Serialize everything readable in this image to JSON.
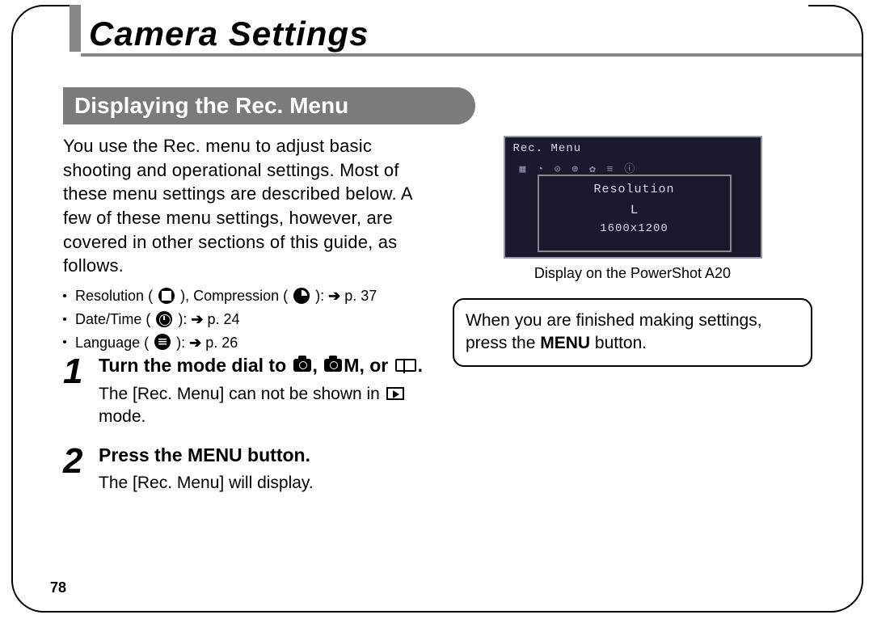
{
  "page_title": "Camera Settings",
  "section_heading": "Displaying the Rec. Menu",
  "intro": "You use the Rec. menu to adjust basic shooting and operational settings. Most of these menu settings are described below. A few of these menu settings, however, are covered in other sections of this guide, as follows.",
  "bullets": {
    "b1_a": "Resolution (",
    "b1_b": "), Compression (",
    "b1_c": "): ",
    "b1_ref": "p. 37",
    "b2_a": "Date/Time (",
    "b2_b": "): ",
    "b2_ref": "p. 24",
    "b3_a": "Language (",
    "b3_b": "): ",
    "b3_ref": "p. 26"
  },
  "arrow": "➔",
  "steps": {
    "s1_num": "1",
    "s1_head_a": "Turn the mode dial to ",
    "s1_head_b": ", ",
    "s1_head_c": "M, or ",
    "s1_head_d": ".",
    "s1_desc_a": "The [Rec. Menu] can not be shown in ",
    "s1_desc_b": " mode.",
    "s2_num": "2",
    "s2_head": "Press the MENU button.",
    "s2_desc": "The [Rec. Menu] will display."
  },
  "lcd": {
    "title": "Rec. Menu",
    "resolution_label": "Resolution",
    "size_letter": "L",
    "dimensions": "1600x1200",
    "caption": "Display on the PowerShot A20"
  },
  "note_a": "When you are finished making settings, press the ",
  "note_bold": "MENU",
  "note_b": " button.",
  "page_number": "78"
}
